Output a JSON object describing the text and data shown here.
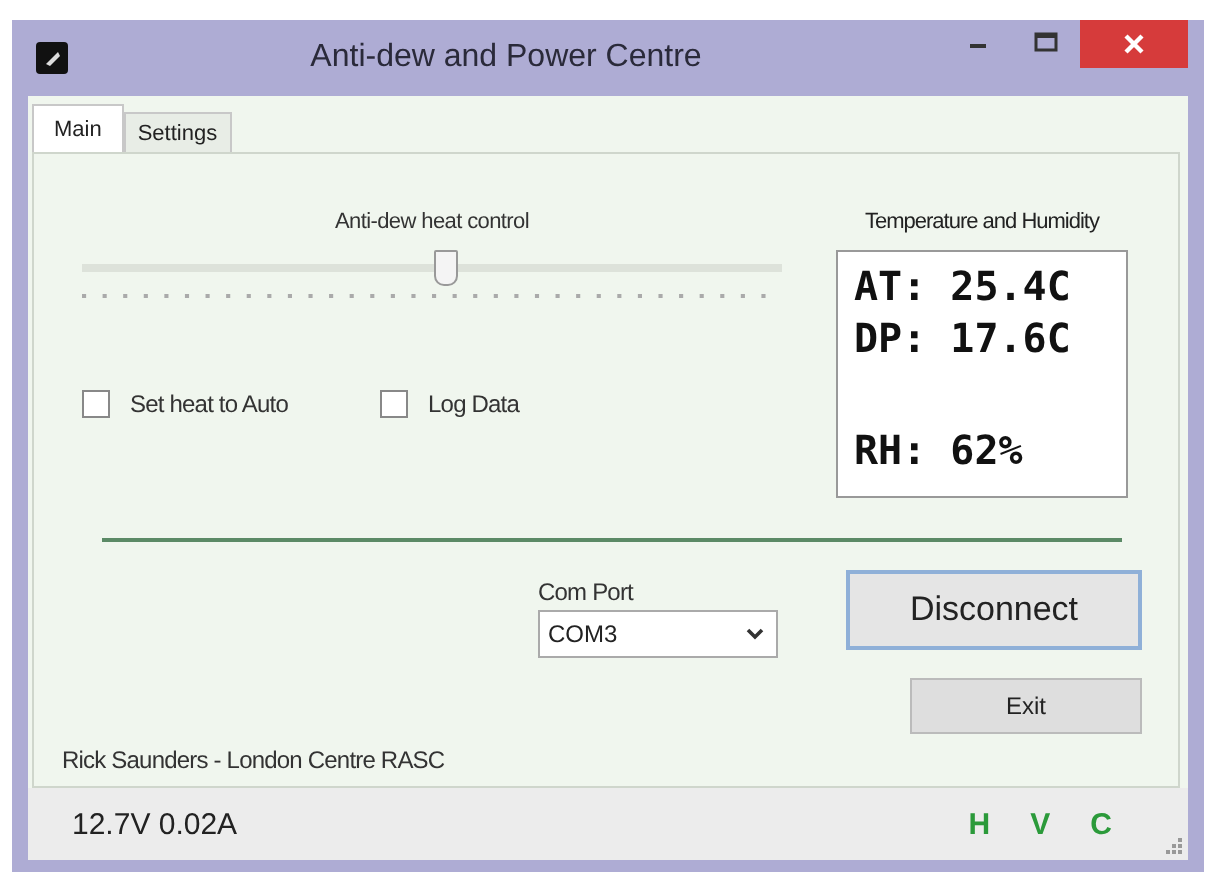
{
  "window": {
    "title": "Anti-dew and Power Centre"
  },
  "tabs": [
    {
      "label": "Main",
      "selected": true
    },
    {
      "label": "Settings",
      "selected": false
    }
  ],
  "heat_control": {
    "label": "Anti-dew heat control",
    "level": 0.52
  },
  "checkboxes": [
    {
      "label": "Set heat to Auto",
      "checked": false
    },
    {
      "label": "Log Data",
      "checked": false
    }
  ],
  "readings": {
    "title": "Temperature and Humidity",
    "lines": [
      "AT: 25.4C",
      "DP: 17.6C",
      "RH: 62%"
    ]
  },
  "com_port": {
    "label": "Com Port",
    "value": "COM3"
  },
  "buttons": {
    "connect": "Disconnect",
    "exit": "Exit"
  },
  "credit": "Rick Saunders - London Centre RASC",
  "status_bar": {
    "power": "12.7V 0.02A",
    "indicators": [
      "H",
      "V",
      "C"
    ]
  }
}
